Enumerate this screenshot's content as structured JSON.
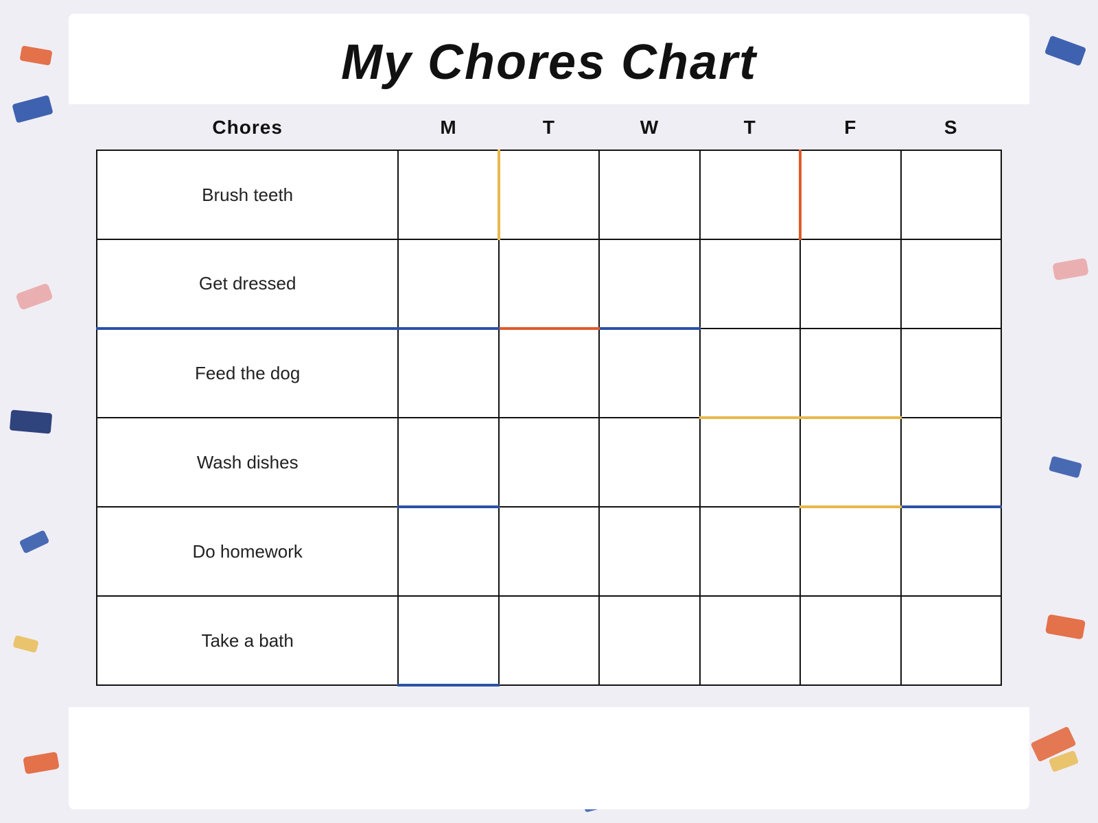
{
  "title": "My Chores Chart",
  "headers": {
    "chores": "Chores",
    "days": [
      "M",
      "T",
      "W",
      "T",
      "F",
      "S"
    ]
  },
  "chores": [
    "Brush teeth",
    "Get dressed",
    "Feed the dog",
    "Wash dishes",
    "Do homework",
    "Take a bath"
  ],
  "colors": {
    "background": "#f0eef5",
    "white": "#ffffff",
    "border": "#111111",
    "yellow": "#e8b84b",
    "blue": "#2a52a7",
    "orange": "#e05a2b",
    "pink": "#e8a0a0",
    "darkBlue": "#1a3070"
  }
}
